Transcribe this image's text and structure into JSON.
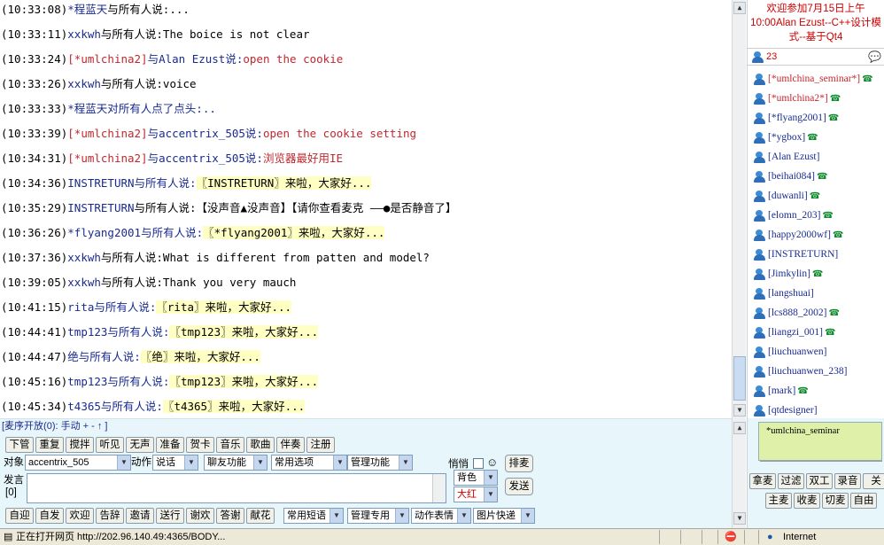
{
  "chat": {
    "messages": [
      {
        "time": "(10:33:08)",
        "parts": [
          {
            "t": "*程蓝天",
            "c": "blue"
          },
          {
            "t": "与所有人说:...",
            "c": ""
          }
        ]
      },
      {
        "time": "(10:33:11)",
        "parts": [
          {
            "t": "xxkwh",
            "c": "blue"
          },
          {
            "t": "与所有人说:The boice is not clear",
            "c": ""
          }
        ]
      },
      {
        "time": "(10:33:24)",
        "parts": [
          {
            "t": "[*umlchina2]",
            "c": "red"
          },
          {
            "t": "与Alan Ezust说:",
            "c": "blue"
          },
          {
            "t": "open the cookie",
            "c": "red"
          }
        ]
      },
      {
        "time": "(10:33:26)",
        "parts": [
          {
            "t": "xxkwh",
            "c": "blue"
          },
          {
            "t": "与所有人说:voice",
            "c": ""
          }
        ]
      },
      {
        "time": "(10:33:33)",
        "parts": [
          {
            "t": "*程蓝天对所有人点了点头:..",
            "c": "blue"
          }
        ]
      },
      {
        "time": "(10:33:39)",
        "parts": [
          {
            "t": "[*umlchina2]",
            "c": "red"
          },
          {
            "t": "与accentrix_505说:",
            "c": "blue"
          },
          {
            "t": "open the cookie setting",
            "c": "red"
          }
        ]
      },
      {
        "time": "(10:34:31)",
        "parts": [
          {
            "t": "[*umlchina2]",
            "c": "red"
          },
          {
            "t": "与accentrix_505说:",
            "c": "blue"
          },
          {
            "t": "浏览器最好用IE",
            "c": "red"
          }
        ]
      },
      {
        "time": "(10:34:36)",
        "parts": [
          {
            "t": "INSTRETURN",
            "c": "blue"
          },
          {
            "t": "与所有人说:",
            "c": "blue"
          },
          {
            "t": "〖INSTRETURN〗来啦，大家好...",
            "c": "hl"
          }
        ]
      },
      {
        "time": "(10:35:29)",
        "parts": [
          {
            "t": "INSTRETURN",
            "c": "blue"
          },
          {
            "t": "与所有人说:【没声音▲没声音】【请你查看麦克 ——●是否静音了】",
            "c": ""
          }
        ]
      },
      {
        "time": "(10:36:26)",
        "parts": [
          {
            "t": "*flyang2001",
            "c": "blue"
          },
          {
            "t": "与所有人说:",
            "c": "blue"
          },
          {
            "t": "〖*flyang2001〗来啦，大家好...",
            "c": "hl"
          }
        ]
      },
      {
        "time": "(10:37:36)",
        "parts": [
          {
            "t": "xxkwh",
            "c": "blue"
          },
          {
            "t": "与所有人说:What is different from patten and model?",
            "c": ""
          }
        ]
      },
      {
        "time": "(10:39:05)",
        "parts": [
          {
            "t": "xxkwh",
            "c": "blue"
          },
          {
            "t": "与所有人说:Thank you very mauch",
            "c": ""
          }
        ]
      },
      {
        "time": "(10:41:15)",
        "parts": [
          {
            "t": "rita",
            "c": "blue"
          },
          {
            "t": "与所有人说:",
            "c": "blue"
          },
          {
            "t": "〖rita〗来啦，大家好...",
            "c": "hl"
          }
        ]
      },
      {
        "time": "(10:44:41)",
        "parts": [
          {
            "t": "tmp123",
            "c": "blue"
          },
          {
            "t": "与所有人说:",
            "c": "blue"
          },
          {
            "t": "〖tmp123〗来啦，大家好...",
            "c": "hl"
          }
        ]
      },
      {
        "time": "(10:44:47)",
        "parts": [
          {
            "t": "绝",
            "c": "blue"
          },
          {
            "t": "与所有人说:",
            "c": "blue"
          },
          {
            "t": "〖绝〗来啦，大家好...",
            "c": "hl"
          }
        ]
      },
      {
        "time": "(10:45:16)",
        "parts": [
          {
            "t": "tmp123",
            "c": "blue"
          },
          {
            "t": "与所有人说:",
            "c": "blue"
          },
          {
            "t": "〖tmp123〗来啦，大家好...",
            "c": "hl"
          }
        ]
      },
      {
        "time": "(10:45:34)",
        "parts": [
          {
            "t": "t4365",
            "c": "blue"
          },
          {
            "t": "与所有人说:",
            "c": "blue"
          },
          {
            "t": "〖t4365〗来啦，大家好...",
            "c": "hl"
          }
        ]
      }
    ]
  },
  "notice": "欢迎参加7月15日上午10:00Alan Ezust--C++设计模式--基于Qt4",
  "user_count": "23",
  "users": [
    {
      "name": "[*umlchina_seminar*]",
      "red": true,
      "phone": true
    },
    {
      "name": "[*umlchina2*]",
      "red": true,
      "phone": true
    },
    {
      "name": "[*flyang2001]",
      "red": false,
      "phone": true
    },
    {
      "name": "[*ygbox]",
      "red": false,
      "phone": true
    },
    {
      "name": "[Alan Ezust]",
      "red": false,
      "phone": false
    },
    {
      "name": "[beihai084]",
      "red": false,
      "phone": true
    },
    {
      "name": "[duwanli]",
      "red": false,
      "phone": true
    },
    {
      "name": "[elomn_203]",
      "red": false,
      "phone": true
    },
    {
      "name": "[happy2000wf]",
      "red": false,
      "phone": true
    },
    {
      "name": "[INSTRETURN]",
      "red": false,
      "phone": false
    },
    {
      "name": "[Jimkylin]",
      "red": false,
      "phone": true
    },
    {
      "name": "[langshuai]",
      "red": false,
      "phone": false
    },
    {
      "name": "[lcs888_2002]",
      "red": false,
      "phone": true
    },
    {
      "name": "[liangzi_001]",
      "red": false,
      "phone": true
    },
    {
      "name": "[liuchuanwen]",
      "red": false,
      "phone": false
    },
    {
      "name": "[liuchuanwen_238]",
      "red": false,
      "phone": false
    },
    {
      "name": "[mark]",
      "red": false,
      "phone": true
    },
    {
      "name": "[qtdesigner]",
      "red": false,
      "phone": false
    }
  ],
  "mic_status": "[麦序开放(0): 手动 + - ↑ ]",
  "toolbar1": [
    "下管",
    "重复",
    "搅拌",
    "听见",
    "无声",
    "准备",
    "贺卡",
    "音乐",
    "歌曲",
    "伴奏",
    "注册"
  ],
  "target_label": "对象",
  "target_value": "accentrix_505",
  "action_label": "动作",
  "action_value": "说话",
  "dropdowns_row": [
    "聊友功能",
    "常用选项",
    "管理功能"
  ],
  "whisper_label": "悄悄",
  "smile_icon": "☺",
  "order_button": "排麦",
  "speak_label": "发言",
  "speak_count": "[0]",
  "bg_color_label": "背色",
  "font_size_value": "大红",
  "send_button": "发送",
  "toolbar2": [
    "自迎",
    "自发",
    "欢迎",
    "告辞",
    "邀请",
    "送行",
    "谢欢",
    "答谢",
    "献花"
  ],
  "toolbar2_dropdowns": [
    "常用短语",
    "管理专用",
    "动作表情",
    "图片快递"
  ],
  "right_green": "*umlchina_seminar",
  "right_buttons_row1": [
    "拿麦",
    "过滤",
    "双工",
    "录音",
    "关"
  ],
  "right_buttons_row2": [
    "主麦",
    "收麦",
    "切麦",
    "自由"
  ],
  "status": {
    "text": "正在打开网页 http://202.96.140.49:4365/BODY...",
    "zone": "Internet"
  }
}
